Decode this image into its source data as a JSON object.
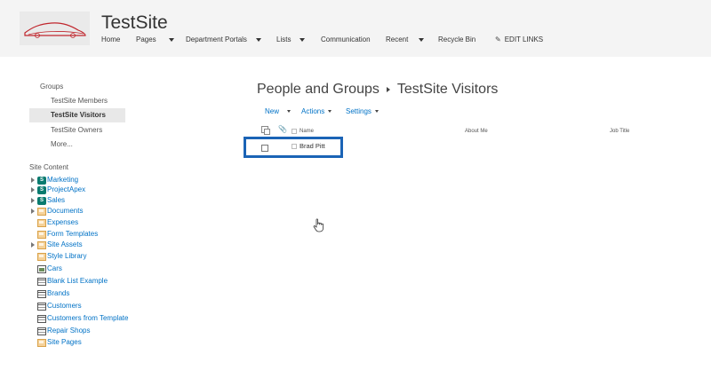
{
  "header": {
    "site_title": "TestSite",
    "nav": [
      {
        "label": "Home",
        "has_dropdown": false
      },
      {
        "label": "Pages",
        "has_dropdown": true
      },
      {
        "label": "Department Portals",
        "has_dropdown": true
      },
      {
        "label": "Lists",
        "has_dropdown": true
      },
      {
        "label": "Communication",
        "has_dropdown": false
      },
      {
        "label": "Recent",
        "has_dropdown": true
      },
      {
        "label": "Recycle Bin",
        "has_dropdown": false
      },
      {
        "label": "EDIT LINKS",
        "has_dropdown": false
      }
    ]
  },
  "leftnav": {
    "groups_heading": "Groups",
    "groups": [
      {
        "label": "TestSite Members",
        "selected": false
      },
      {
        "label": "TestSite Visitors",
        "selected": true
      },
      {
        "label": "TestSite Owners",
        "selected": false
      },
      {
        "label": "More...",
        "selected": false
      }
    ],
    "site_content_heading": "Site Content",
    "site_content": [
      {
        "label": "Marketing",
        "icon": "subsite-icon",
        "expandable": true
      },
      {
        "label": "ProjectApex",
        "icon": "subsite-icon",
        "expandable": true
      },
      {
        "label": "Sales",
        "icon": "subsite-icon",
        "expandable": true
      },
      {
        "label": "Documents",
        "icon": "library-icon",
        "expandable": true
      },
      {
        "label": "Expenses",
        "icon": "library-icon",
        "expandable": false
      },
      {
        "label": "Form Templates",
        "icon": "library-icon",
        "expandable": false
      },
      {
        "label": "Site Assets",
        "icon": "library-icon",
        "expandable": true
      },
      {
        "label": "Style Library",
        "icon": "library-icon",
        "expandable": false
      },
      {
        "label": "Cars",
        "icon": "picture-library-icon",
        "expandable": false
      },
      {
        "label": "Blank List Example",
        "icon": "list-icon",
        "expandable": false
      },
      {
        "label": "Brands",
        "icon": "list-icon",
        "expandable": false
      },
      {
        "label": "Customers",
        "icon": "list-icon",
        "expandable": false
      },
      {
        "label": "Customers from Template",
        "icon": "list-icon",
        "expandable": false
      },
      {
        "label": "Repair Shops",
        "icon": "list-icon",
        "expandable": false
      },
      {
        "label": "Site Pages",
        "icon": "library-icon",
        "expandable": false
      }
    ]
  },
  "main": {
    "breadcrumb_root": "People and Groups",
    "breadcrumb_current": "TestSite Visitors",
    "toolbar": {
      "new_label": "New",
      "actions_label": "Actions",
      "settings_label": "Settings"
    },
    "columns": {
      "name": "Name",
      "about_me": "About Me",
      "job_title": "Job Title"
    },
    "rows": [
      {
        "name": "Brad Pitt",
        "about_me": "",
        "job_title": ""
      }
    ]
  },
  "colors": {
    "link": "#0072c6",
    "highlight_border": "#1b64b6",
    "subsite_icon": "#0a7b6f",
    "header_bg": "#f4f4f4"
  }
}
